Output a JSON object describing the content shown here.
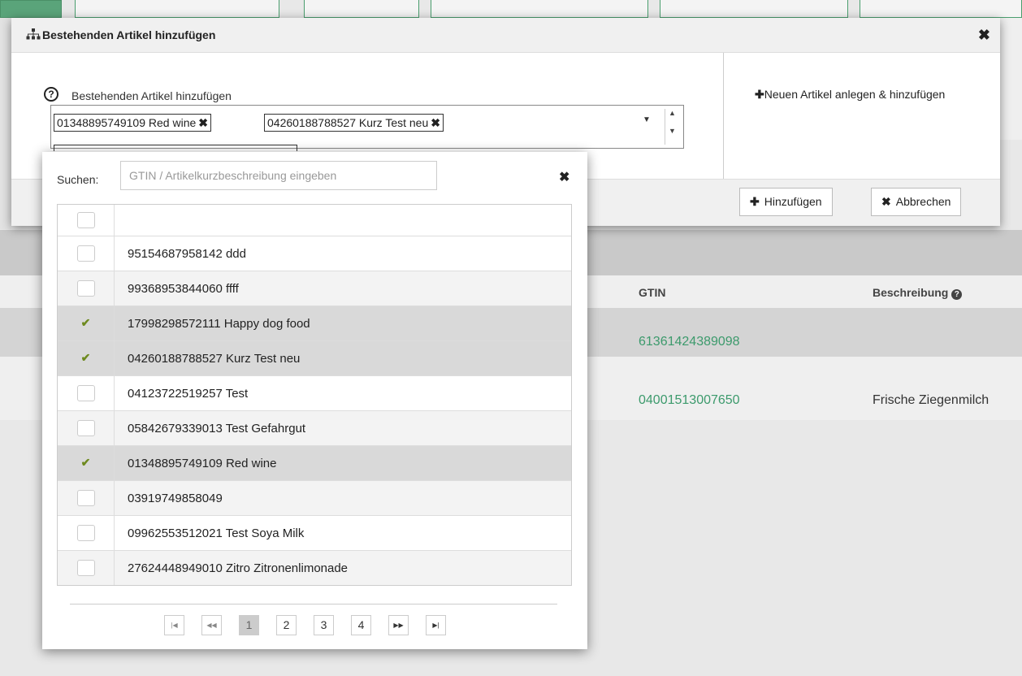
{
  "modal": {
    "title": "Bestehenden Artikel hinzufügen",
    "field_label": "Bestehenden Artikel hinzufügen",
    "selected_chips": [
      {
        "label": "01348895749109 Red wine"
      },
      {
        "label": "04260188788527 Kurz Test neu"
      }
    ],
    "new_article_label": "Neuen Artikel anlegen & hinzufügen",
    "add_button": "Hinzufügen",
    "cancel_button": "Abbrechen"
  },
  "popup": {
    "search_label": "Suchen:",
    "search_placeholder": "GTIN / Artikelkurzbeschreibung eingeben",
    "items": [
      {
        "label": "95154687958142 ddd",
        "checked": false
      },
      {
        "label": "99368953844060 ffff",
        "checked": false
      },
      {
        "label": "17998298572111 Happy dog food",
        "checked": true
      },
      {
        "label": "04260188788527 Kurz Test neu",
        "checked": true
      },
      {
        "label": "04123722519257 Test",
        "checked": false
      },
      {
        "label": "05842679339013 Test Gefahrgut",
        "checked": false
      },
      {
        "label": "01348895749109 Red wine",
        "checked": true
      },
      {
        "label": "03919749858049",
        "checked": false
      },
      {
        "label": "09962553512021 Test Soya Milk",
        "checked": false
      },
      {
        "label": "27624448949010 Zitro Zitronenlimonade",
        "checked": false
      }
    ],
    "pagination": {
      "pages": [
        "1",
        "2",
        "3",
        "4"
      ],
      "current": "1"
    }
  },
  "background": {
    "gtin_header": "GTIN",
    "desc_header": "Beschreibung",
    "rows": [
      {
        "gtin": "61361424389098",
        "desc": ""
      },
      {
        "gtin": "04001513007650",
        "desc": "Frische Ziegenmilch"
      }
    ],
    "colors": {
      "accent": "#3c9a6c",
      "check": "#6e8a1f"
    }
  }
}
